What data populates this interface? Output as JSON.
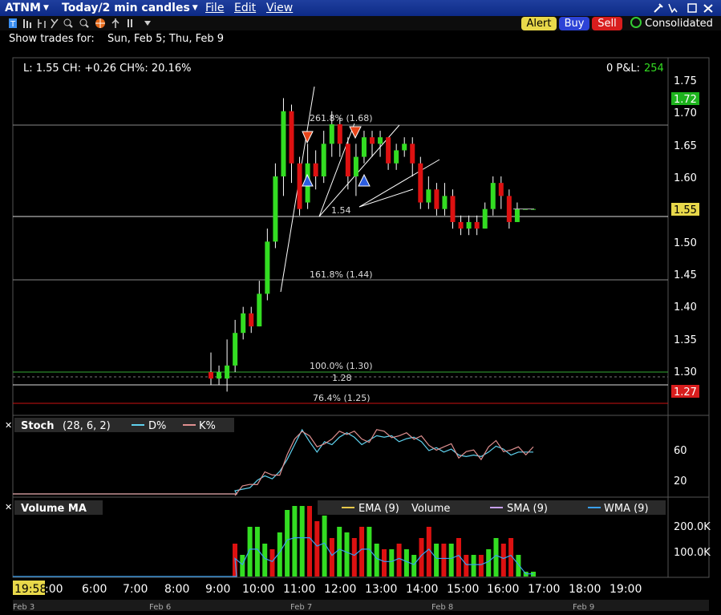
{
  "header": {
    "symbol": "ATNM",
    "period": "Today/2 min candles",
    "menu": [
      "File",
      "Edit",
      "View"
    ],
    "buttons": {
      "alert": "Alert",
      "buy": "Buy",
      "sell": "Sell"
    },
    "consolidated": "Consolidated"
  },
  "show_trades": {
    "label": "Show trades for:",
    "value": "Sun, Feb 5; Thu, Feb 9"
  },
  "quote_bar": {
    "text": "L: 1.55 CH: +0.26 CH%: 20.16%",
    "pnl_label": "0 P&L:",
    "pnl_value": "254"
  },
  "price_axis": {
    "ticks": [
      "1.75",
      "1.70",
      "1.65",
      "1.60",
      "1.55",
      "1.50",
      "1.45",
      "1.40",
      "1.35",
      "1.30"
    ],
    "last_price": "1.72",
    "current_price": "1.55",
    "low_marker": "1.27"
  },
  "annotations": {
    "fib_261": "261.8% (1.68)",
    "fib_161": "161.8% (1.44)",
    "fib_100": "100.0% (1.30)",
    "fib_76": "76.4% (1.25)",
    "level_154": "1.54",
    "level_128": "1.28"
  },
  "stoch": {
    "title": "Stoch",
    "params": "(28, 6, 2)",
    "d_label": "D%",
    "k_label": "K%",
    "ticks": [
      "60",
      "20"
    ]
  },
  "volume": {
    "title": "Volume MA",
    "legend": [
      "EMA (9)",
      "Volume",
      "SMA (9)",
      "WMA (9)"
    ],
    "ticks": [
      "200.0K",
      "100.0K"
    ]
  },
  "time_axis": {
    "start_label": "19:58",
    "times": [
      ":00",
      "6:00",
      "7:00",
      "8:00",
      "9:00",
      "10:00",
      "11:00",
      "12:00",
      "13:00",
      "14:00",
      "15:00",
      "16:00",
      "17:00",
      "18:00",
      "19:00"
    ],
    "dates": [
      "Feb 3",
      "Feb 6",
      "Feb 7",
      "Feb 8",
      "Feb 9"
    ]
  },
  "colors": {
    "up": "#33dd22",
    "down": "#dd1111",
    "alert_bg": "#e8d84a",
    "buy_bg": "#2d43d6",
    "sell_bg": "#d81d1d",
    "d_line": "#5fd1ee",
    "k_line": "#e09090"
  },
  "chart_data": {
    "type": "candlestick",
    "y_range": [
      1.22,
      1.77
    ],
    "candles": [
      {
        "t": "09:30",
        "o": 1.3,
        "c": 1.29,
        "h": 1.33,
        "l": 1.28
      },
      {
        "t": "09:40",
        "o": 1.29,
        "c": 1.3,
        "h": 1.31,
        "l": 1.28
      },
      {
        "t": "09:50",
        "o": 1.29,
        "c": 1.31,
        "h": 1.35,
        "l": 1.27
      },
      {
        "t": "10:00",
        "o": 1.31,
        "c": 1.36,
        "h": 1.38,
        "l": 1.3
      },
      {
        "t": "10:10",
        "o": 1.36,
        "c": 1.39,
        "h": 1.4,
        "l": 1.35
      },
      {
        "t": "10:20",
        "o": 1.39,
        "c": 1.37,
        "h": 1.4,
        "l": 1.36
      },
      {
        "t": "10:30",
        "o": 1.37,
        "c": 1.42,
        "h": 1.44,
        "l": 1.37
      },
      {
        "t": "10:40",
        "o": 1.42,
        "c": 1.5,
        "h": 1.52,
        "l": 1.41
      },
      {
        "t": "10:50",
        "o": 1.5,
        "c": 1.6,
        "h": 1.62,
        "l": 1.49
      },
      {
        "t": "11:00",
        "o": 1.6,
        "c": 1.7,
        "h": 1.72,
        "l": 1.57
      },
      {
        "t": "11:10",
        "o": 1.7,
        "c": 1.62,
        "h": 1.71,
        "l": 1.59
      },
      {
        "t": "11:20",
        "o": 1.62,
        "c": 1.55,
        "h": 1.63,
        "l": 1.54
      },
      {
        "t": "11:30",
        "o": 1.56,
        "c": 1.62,
        "h": 1.65,
        "l": 1.55
      },
      {
        "t": "11:40",
        "o": 1.62,
        "c": 1.6,
        "h": 1.64,
        "l": 1.58
      },
      {
        "t": "11:50",
        "o": 1.6,
        "c": 1.65,
        "h": 1.67,
        "l": 1.59
      },
      {
        "t": "12:00",
        "o": 1.65,
        "c": 1.68,
        "h": 1.7,
        "l": 1.63
      },
      {
        "t": "12:10",
        "o": 1.68,
        "c": 1.65,
        "h": 1.69,
        "l": 1.63
      },
      {
        "t": "12:20",
        "o": 1.65,
        "c": 1.6,
        "h": 1.66,
        "l": 1.58
      },
      {
        "t": "12:30",
        "o": 1.6,
        "c": 1.63,
        "h": 1.65,
        "l": 1.57
      },
      {
        "t": "12:40",
        "o": 1.63,
        "c": 1.66,
        "h": 1.67,
        "l": 1.62
      },
      {
        "t": "12:50",
        "o": 1.66,
        "c": 1.65,
        "h": 1.67,
        "l": 1.63
      },
      {
        "t": "13:00",
        "o": 1.65,
        "c": 1.66,
        "h": 1.67,
        "l": 1.63
      },
      {
        "t": "13:10",
        "o": 1.66,
        "c": 1.62,
        "h": 1.66,
        "l": 1.61
      },
      {
        "t": "13:20",
        "o": 1.62,
        "c": 1.64,
        "h": 1.65,
        "l": 1.61
      },
      {
        "t": "13:30",
        "o": 1.64,
        "c": 1.65,
        "h": 1.66,
        "l": 1.63
      },
      {
        "t": "13:40",
        "o": 1.65,
        "c": 1.62,
        "h": 1.66,
        "l": 1.6
      },
      {
        "t": "13:50",
        "o": 1.62,
        "c": 1.56,
        "h": 1.63,
        "l": 1.55
      },
      {
        "t": "14:00",
        "o": 1.56,
        "c": 1.58,
        "h": 1.6,
        "l": 1.55
      },
      {
        "t": "14:10",
        "o": 1.58,
        "c": 1.55,
        "h": 1.59,
        "l": 1.54
      },
      {
        "t": "14:20",
        "o": 1.55,
        "c": 1.57,
        "h": 1.59,
        "l": 1.54
      },
      {
        "t": "14:30",
        "o": 1.57,
        "c": 1.53,
        "h": 1.58,
        "l": 1.52
      },
      {
        "t": "14:40",
        "o": 1.53,
        "c": 1.52,
        "h": 1.54,
        "l": 1.51
      },
      {
        "t": "14:50",
        "o": 1.52,
        "c": 1.53,
        "h": 1.54,
        "l": 1.51
      },
      {
        "t": "15:00",
        "o": 1.53,
        "c": 1.52,
        "h": 1.54,
        "l": 1.51
      },
      {
        "t": "15:10",
        "o": 1.52,
        "c": 1.55,
        "h": 1.56,
        "l": 1.52
      },
      {
        "t": "15:20",
        "o": 1.55,
        "c": 1.59,
        "h": 1.6,
        "l": 1.54
      },
      {
        "t": "15:30",
        "o": 1.59,
        "c": 1.57,
        "h": 1.6,
        "l": 1.55
      },
      {
        "t": "15:40",
        "o": 1.57,
        "c": 1.53,
        "h": 1.58,
        "l": 1.52
      },
      {
        "t": "15:50",
        "o": 1.53,
        "c": 1.55,
        "h": 1.56,
        "l": 1.53
      },
      {
        "t": "16:00",
        "o": 1.55,
        "c": 1.55,
        "h": 1.55,
        "l": 1.55
      },
      {
        "t": "16:10",
        "o": 1.55,
        "c": 1.55,
        "h": 1.55,
        "l": 1.55
      }
    ]
  }
}
